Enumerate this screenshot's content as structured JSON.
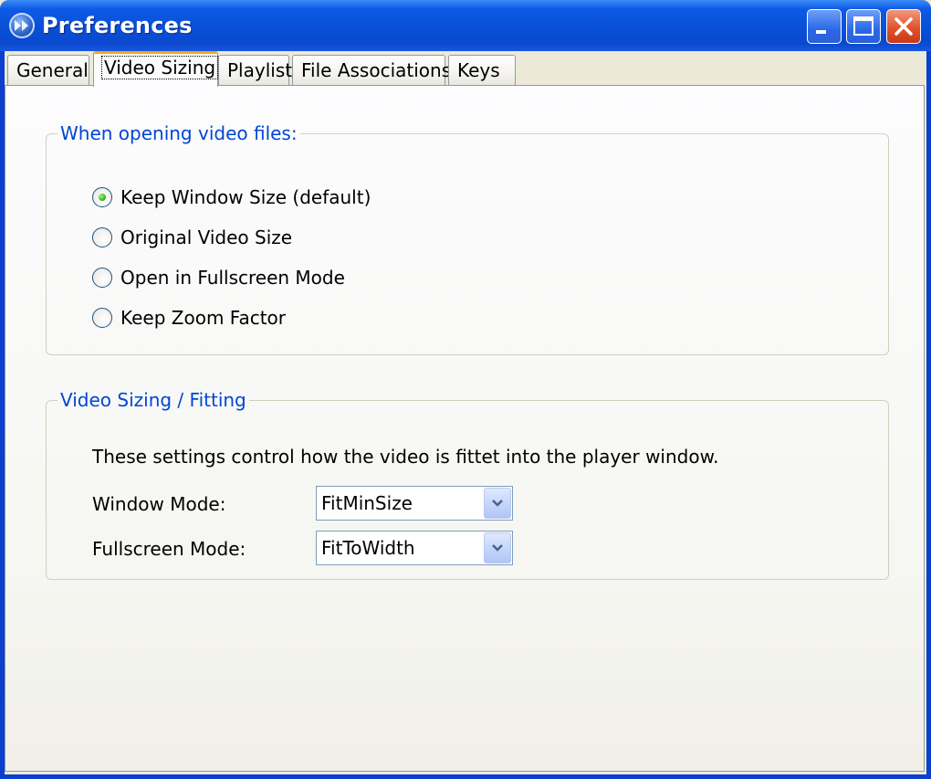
{
  "window": {
    "title": "Preferences",
    "app_icon": "media-player-icon",
    "controls": [
      "minimize-icon",
      "maximize-icon",
      "close-icon"
    ]
  },
  "tabs": [
    {
      "label": "General",
      "active": false
    },
    {
      "label": "Video Sizing",
      "active": true
    },
    {
      "label": "Playlist",
      "active": false
    },
    {
      "label": "File Associations",
      "active": false
    },
    {
      "label": "Keys",
      "active": false
    }
  ],
  "opening_group": {
    "legend": "When opening video files:",
    "options": [
      {
        "label": "Keep Window Size (default)",
        "checked": true
      },
      {
        "label": "Original Video Size",
        "checked": false
      },
      {
        "label": "Open in Fullscreen Mode",
        "checked": false
      },
      {
        "label": "Keep Zoom Factor",
        "checked": false
      }
    ]
  },
  "fitting_group": {
    "legend": "Video Sizing / Fitting",
    "description": "These settings control how the video is fittet into the player window.",
    "window_mode": {
      "label": "Window Mode:",
      "value": "FitMinSize"
    },
    "fullscreen_mode": {
      "label": "Fullscreen Mode:",
      "value": "FitToWidth"
    }
  },
  "colors": {
    "title_bar": "#0a4fd8",
    "group_legend": "#0046d5",
    "active_tab_highlight": "#f5a623",
    "close_button": "#e0522c"
  }
}
